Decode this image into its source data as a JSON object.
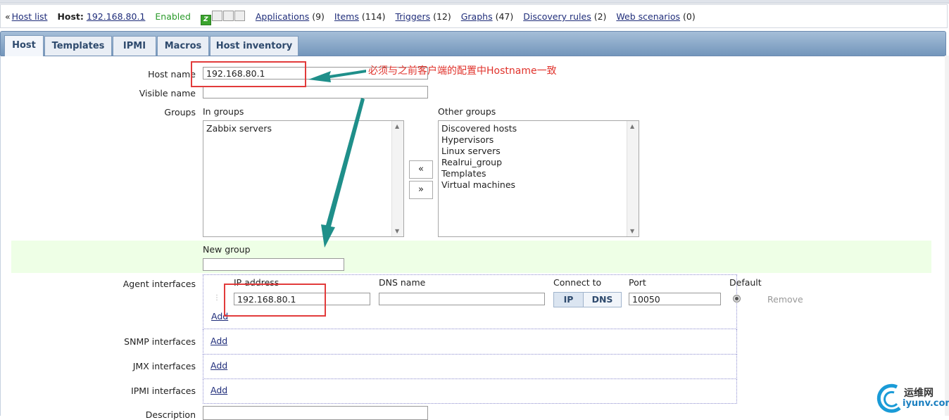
{
  "nav": {
    "host_list": "Host list",
    "host_label": "Host:",
    "host_value": "192.168.80.1",
    "enabled": "Enabled",
    "status_icons": [
      "Z",
      "S",
      "J",
      "I"
    ],
    "applications": "Applications",
    "applications_count": "(9)",
    "items": "Items",
    "items_count": "(114)",
    "triggers": "Triggers",
    "triggers_count": "(12)",
    "graphs": "Graphs",
    "graphs_count": "(47)",
    "discovery": "Discovery rules",
    "discovery_count": "(2)",
    "web": "Web scenarios",
    "web_count": "(0)"
  },
  "tabs": [
    "Host",
    "Templates",
    "IPMI",
    "Macros",
    "Host inventory"
  ],
  "form": {
    "host_name_label": "Host name",
    "host_name_value": "192.168.80.1",
    "visible_name_label": "Visible name",
    "visible_name_value": "",
    "groups_label": "Groups",
    "in_groups_label": "In groups",
    "in_groups": [
      "Zabbix servers"
    ],
    "other_groups_label": "Other groups",
    "other_groups": [
      "Discovered hosts",
      "Hypervisors",
      "Linux servers",
      "Realrui_group",
      "Templates",
      "Virtual machines"
    ],
    "move_left": "«",
    "move_right": "»",
    "new_group_label": "New group",
    "new_group_value": "",
    "agent_label": "Agent interfaces",
    "col_ip": "IP address",
    "col_dns": "DNS name",
    "col_connect": "Connect to",
    "col_port": "Port",
    "col_default": "Default",
    "agent_ip": "192.168.80.1",
    "agent_dns": "",
    "connect_ip": "IP",
    "connect_dns": "DNS",
    "agent_port": "10050",
    "remove": "Remove",
    "add": "Add",
    "snmp_label": "SNMP interfaces",
    "jmx_label": "JMX interfaces",
    "ipmi_label": "IPMI interfaces",
    "description_label": "Description"
  },
  "annotation": "必须与之前客户端的配置中Hostname一致",
  "watermark": {
    "cn": "运维网",
    "domain": "iyunv.com"
  },
  "colors": {
    "accent_red": "#e23b3b",
    "arrow_teal": "#1f8f8a",
    "tab_blue": "#7396bb"
  }
}
